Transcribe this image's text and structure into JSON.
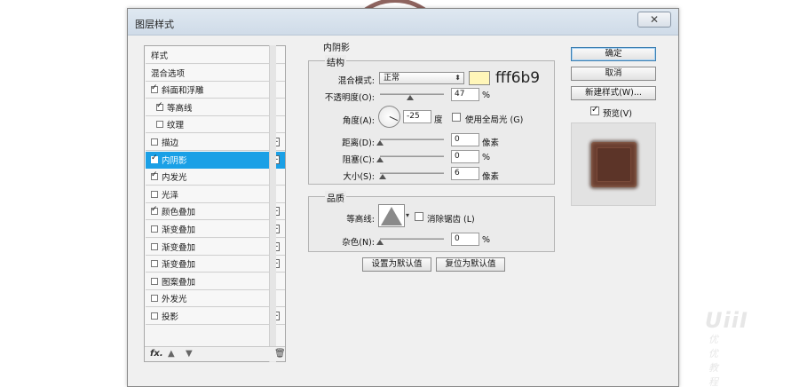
{
  "window": {
    "title": "图层样式",
    "close_label": "✕"
  },
  "sidebar": {
    "items": [
      {
        "label": "样式",
        "checkbox": false,
        "checked": false,
        "plus": false
      },
      {
        "label": "混合选项",
        "checkbox": false,
        "checked": false,
        "plus": false
      },
      {
        "label": "斜面和浮雕",
        "checkbox": true,
        "checked": true,
        "plus": false
      },
      {
        "label": "等高线",
        "checkbox": true,
        "checked": true,
        "plus": false,
        "indent": true
      },
      {
        "label": "纹理",
        "checkbox": true,
        "checked": false,
        "plus": false,
        "indent": true
      },
      {
        "label": "描边",
        "checkbox": true,
        "checked": false,
        "plus": true
      },
      {
        "label": "内阴影",
        "checkbox": true,
        "checked": true,
        "plus": true,
        "active": true
      },
      {
        "label": "内发光",
        "checkbox": true,
        "checked": true,
        "plus": false
      },
      {
        "label": "光泽",
        "checkbox": true,
        "checked": false,
        "plus": false
      },
      {
        "label": "颜色叠加",
        "checkbox": true,
        "checked": true,
        "plus": true
      },
      {
        "label": "渐变叠加",
        "checkbox": true,
        "checked": false,
        "plus": true
      },
      {
        "label": "渐变叠加",
        "checkbox": true,
        "checked": false,
        "plus": true
      },
      {
        "label": "渐变叠加",
        "checkbox": true,
        "checked": false,
        "plus": true
      },
      {
        "label": "图案叠加",
        "checkbox": true,
        "checked": false,
        "plus": false
      },
      {
        "label": "外发光",
        "checkbox": true,
        "checked": false,
        "plus": false
      },
      {
        "label": "投影",
        "checkbox": true,
        "checked": false,
        "plus": true
      }
    ],
    "footer": {
      "fx_label": "fx",
      "fx_dot": "."
    }
  },
  "inner_shadow": {
    "section_title": "内阴影",
    "structure": {
      "title": "结构",
      "blend_mode_label": "混合模式:",
      "blend_mode_value": "正常",
      "color": "#fff6b9",
      "color_hex_label": "fff6b9",
      "opacity_label": "不透明度(O):",
      "opacity_value": "47",
      "opacity_unit": "%",
      "opacity_level": 0.47,
      "angle_label": "角度(A):",
      "angle_value": "-25",
      "angle_unit": "度",
      "global_light_label": "使用全局光 (G)",
      "global_light_checked": false,
      "distance_label": "距离(D):",
      "distance_value": "0",
      "distance_unit": "像素",
      "choke_label": "阻塞(C):",
      "choke_value": "0",
      "choke_unit": "%",
      "size_label": "大小(S):",
      "size_value": "6",
      "size_unit": "像素"
    },
    "quality": {
      "title": "品质",
      "contour_label": "等高线:",
      "antialias_label": "消除锯齿 (L)",
      "antialias_checked": false,
      "noise_label": "杂色(N):",
      "noise_value": "0",
      "noise_unit": "%"
    },
    "set_default_label": "设置为默认值",
    "reset_default_label": "复位为默认值"
  },
  "actions": {
    "ok_label": "确定",
    "cancel_label": "取消",
    "new_style_label": "新建样式(W)...",
    "preview_label": "预览(V)",
    "preview_checked": true
  },
  "watermark": {
    "logo": "UiiI",
    "sub": "优优教程网"
  }
}
